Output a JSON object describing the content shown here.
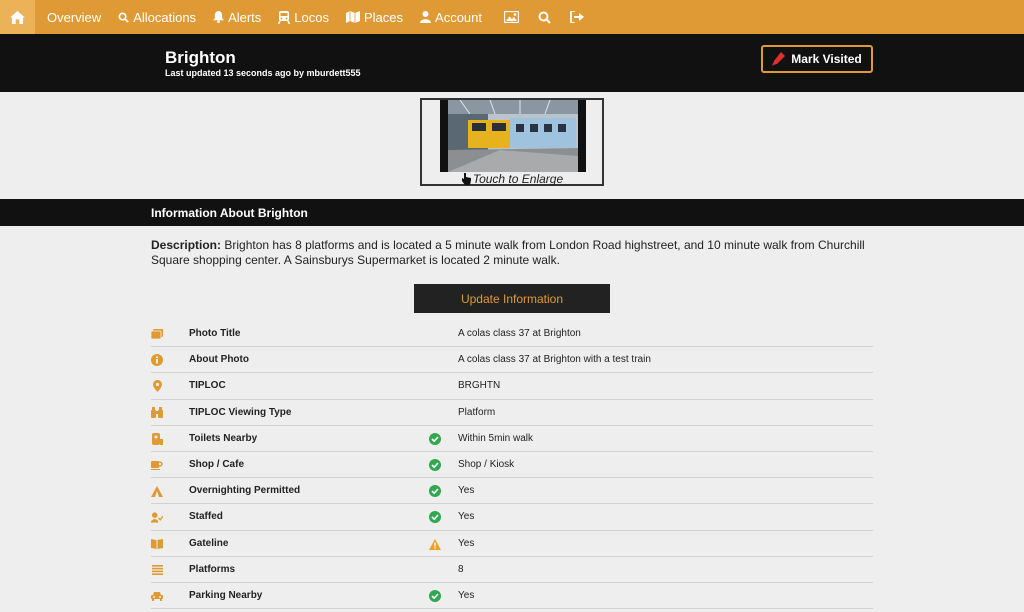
{
  "nav": {
    "items": [
      {
        "label": "Overview",
        "icon": "none"
      },
      {
        "label": "Allocations",
        "icon": "search-icon"
      },
      {
        "label": "Alerts",
        "icon": "bell-icon"
      },
      {
        "label": "Locos",
        "icon": "train-icon"
      },
      {
        "label": "Places",
        "icon": "map-icon"
      },
      {
        "label": "Account",
        "icon": "user-icon"
      }
    ],
    "accent_color": "#e09a35"
  },
  "header": {
    "station": "Brighton",
    "updated": "Last updated 13 seconds ago by mburdett555",
    "mark_visited": "Mark Visited"
  },
  "photo": {
    "caption": "Touch to Enlarge"
  },
  "section": {
    "title": "Information About Brighton"
  },
  "description": {
    "label": "Description:",
    "text": "Brighton has 8 platforms and is located a 5 minute walk from London Road highstreet, and 10 minute walk from Churchill Square shopping center. A Sainsburys Supermarket is located 2 minute walk."
  },
  "update_button": "Update Information",
  "info": [
    {
      "label": "Photo Title",
      "value": "A colas class 37 at Brighton",
      "icon": "photo-icon",
      "status": "none"
    },
    {
      "label": "About Photo",
      "value": "A colas class 37 at Brighton with a test train",
      "icon": "info-icon",
      "status": "none"
    },
    {
      "label": "TIPLOC",
      "value": "BRGHTN",
      "icon": "map-marker-icon",
      "status": "none"
    },
    {
      "label": "TIPLOC Viewing Type",
      "value": "Platform",
      "icon": "binoculars-icon",
      "status": "none"
    },
    {
      "label": "Toilets Nearby",
      "value": "Within 5min walk",
      "icon": "toilet-paper-icon",
      "status": "ok"
    },
    {
      "label": "Shop / Cafe",
      "value": "Shop / Kiosk",
      "icon": "coffee-icon",
      "status": "ok"
    },
    {
      "label": "Overnighting Permitted",
      "value": "Yes",
      "icon": "tent-icon",
      "status": "ok"
    },
    {
      "label": "Staffed",
      "value": "Yes",
      "icon": "staff-icon",
      "status": "ok"
    },
    {
      "label": "Gateline",
      "value": "Yes",
      "icon": "book-icon",
      "status": "warning"
    },
    {
      "label": "Platforms",
      "value": "8",
      "icon": "list-icon",
      "status": "none"
    },
    {
      "label": "Parking Nearby",
      "value": "Yes",
      "icon": "car-icon",
      "status": "ok"
    }
  ]
}
